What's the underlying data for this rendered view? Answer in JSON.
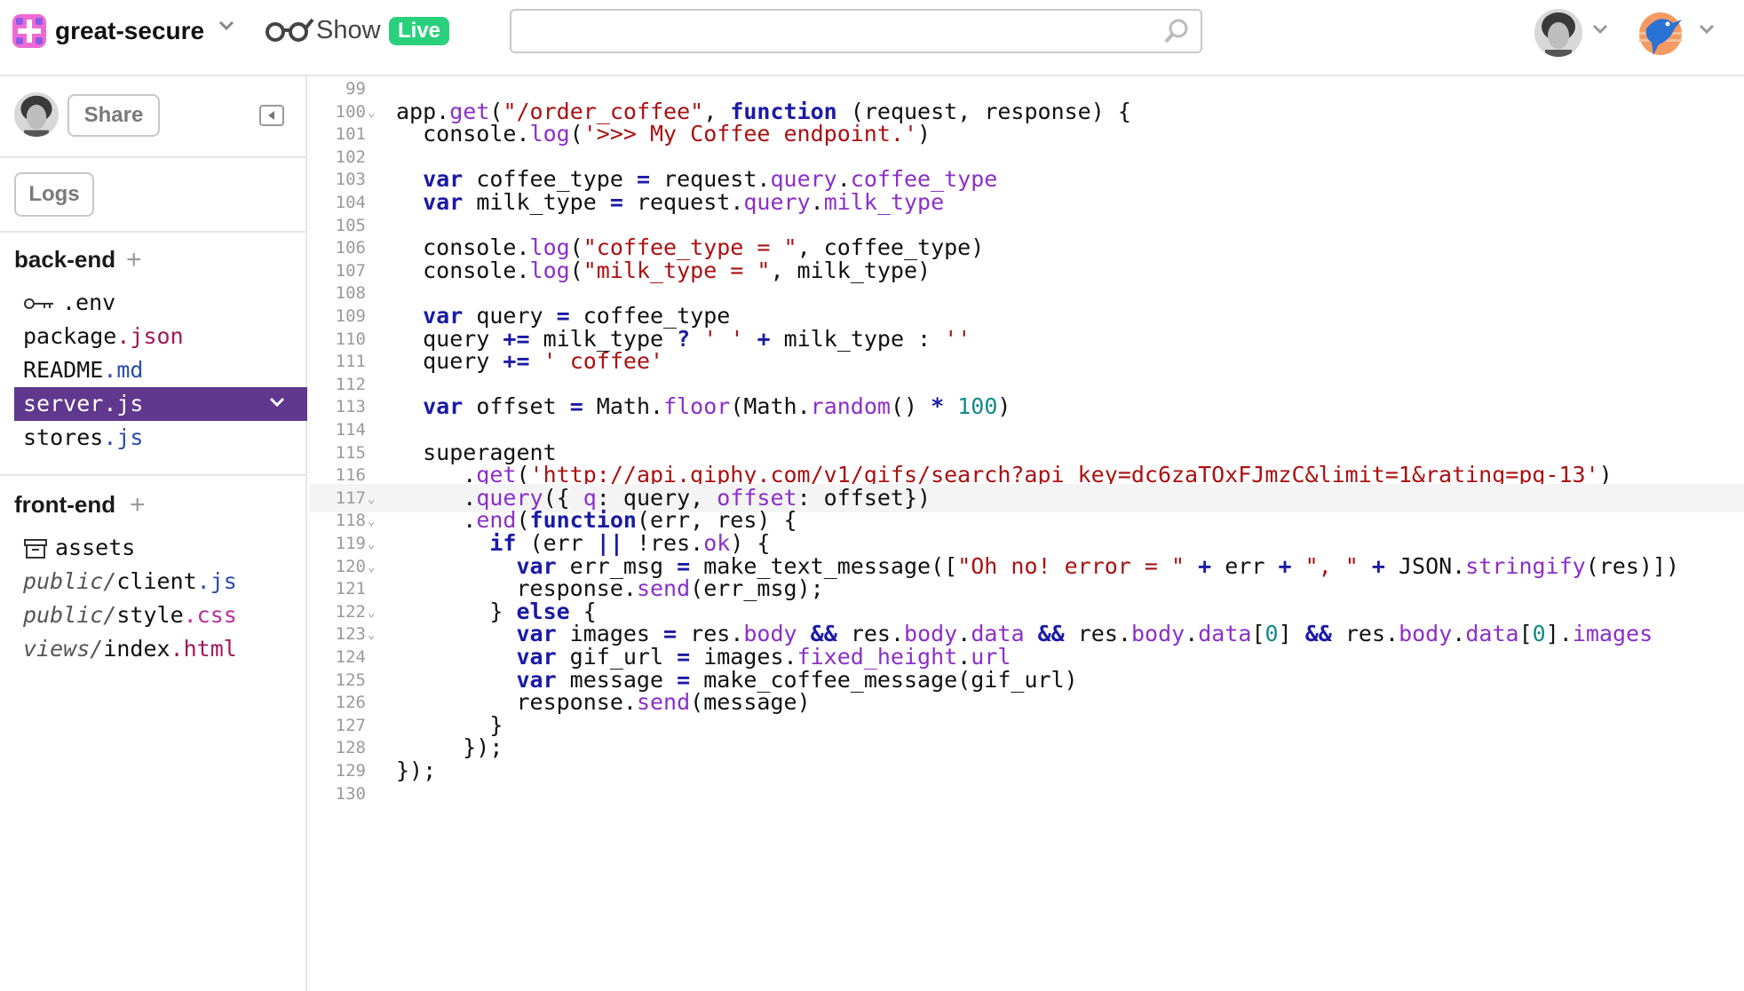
{
  "header": {
    "project_name": "great-secure",
    "show_label": "Show",
    "live_badge": "Live",
    "search_placeholder": ""
  },
  "sidebar": {
    "share_label": "Share",
    "logs_label": "Logs",
    "backend": {
      "title": "back-end",
      "files": [
        {
          "name": ".env",
          "ext": "",
          "icon": "key-icon"
        },
        {
          "name": "package",
          "ext": ".json"
        },
        {
          "name": "README",
          "ext": ".md"
        },
        {
          "name": "server",
          "ext": ".js",
          "selected": true
        },
        {
          "name": "stores",
          "ext": ".js"
        }
      ]
    },
    "frontend": {
      "title": "front-end",
      "files": [
        {
          "name": "assets",
          "ext": "",
          "icon": "archive-icon"
        },
        {
          "dir": "public/",
          "name": "client",
          "ext": ".js"
        },
        {
          "dir": "public/",
          "name": "style",
          "ext": ".css"
        },
        {
          "dir": "views/",
          "name": "index",
          "ext": ".html"
        }
      ]
    }
  },
  "editor": {
    "active_line": 117,
    "line_numbers": [
      "99",
      "100",
      "101",
      "102",
      "103",
      "104",
      "105",
      "106",
      "107",
      "108",
      "109",
      "110",
      "111",
      "112",
      "113",
      "114",
      "115",
      "116",
      "117",
      "118",
      "119",
      "120",
      "121",
      "122",
      "123",
      "124",
      "125",
      "126",
      "127",
      "128",
      "129",
      "130"
    ],
    "folded_lines": [
      "100",
      "117",
      "118",
      "119",
      "120",
      "122",
      "123"
    ],
    "lines": [
      "",
      "app.get(\"/order_coffee\", function (request, response) {",
      "  console.log('>>> My Coffee endpoint.')",
      "",
      "  var coffee_type = request.query.coffee_type",
      "  var milk_type = request.query.milk_type",
      "",
      "  console.log(\"coffee_type = \", coffee_type)",
      "  console.log(\"milk_type = \", milk_type)",
      "",
      "  var query = coffee_type",
      "  query += milk_type ? ' ' + milk_type : ''",
      "  query += ' coffee'",
      "",
      "  var offset = Math.floor(Math.random() * 100)",
      "",
      "  superagent",
      "     .get('http://api.giphy.com/v1/gifs/search?api_key=dc6zaTOxFJmzC&limit=1&rating=pg-13')",
      "     .query({ q: query, offset: offset})",
      "     .end(function(err, res) {",
      "       if (err || !res.ok) {",
      "         var err_msg = make_text_message([\"Oh no! error = \" + err + \", \" + JSON.stringify(res)])",
      "         response.send(err_msg);",
      "       } else {",
      "         var images = res.body && res.body.data && res.body.data[0] && res.body.data[0].images",
      "         var gif_url = images.fixed_height.url",
      "         var message = make_coffee_message(gif_url)",
      "         response.send(message)",
      "       }",
      "     });",
      "});",
      ""
    ]
  },
  "colors": {
    "accent": "#60388d",
    "live": "#2ad07c",
    "keyword": "#1a1aa6",
    "string": "#aa1111",
    "property": "#8b2fc9",
    "number": "#128a8a"
  }
}
